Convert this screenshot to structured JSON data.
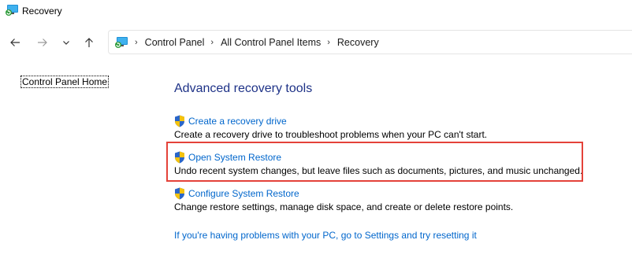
{
  "window": {
    "title": "Recovery"
  },
  "nav": {
    "back": "back-arrow-icon",
    "forward": "forward-arrow-icon",
    "recent": "chevron-down-icon",
    "up": "up-arrow-icon"
  },
  "breadcrumb": {
    "items": [
      "Control Panel",
      "All Control Panel Items",
      "Recovery"
    ]
  },
  "sidebar": {
    "home_link": "Control Panel Home"
  },
  "main": {
    "heading": "Advanced recovery tools",
    "tasks": [
      {
        "link": "Create a recovery drive",
        "desc": "Create a recovery drive to troubleshoot problems when your PC can't start."
      },
      {
        "link": "Open System Restore",
        "desc": "Undo recent system changes, but leave files such as documents, pictures, and music unchanged."
      },
      {
        "link": "Configure System Restore",
        "desc": "Change restore settings, manage disk space, and create or delete restore points."
      }
    ],
    "reset_link": "If you're having problems with your PC, go to Settings and try resetting it"
  },
  "colors": {
    "link": "#0066cc",
    "heading": "#1e3287",
    "highlight": "#e4423a"
  }
}
